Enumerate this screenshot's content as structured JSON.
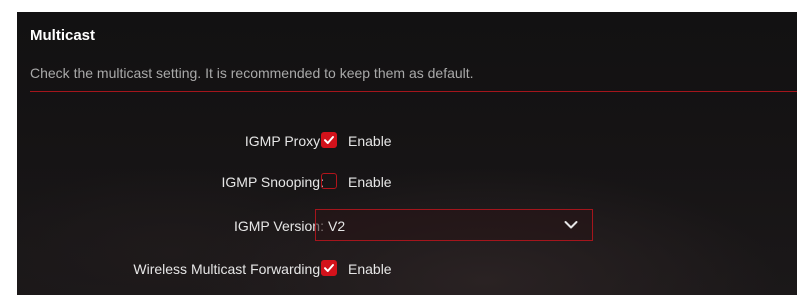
{
  "section": {
    "title": "Multicast",
    "description": "Check the multicast setting. It is recommended to keep them as default."
  },
  "settings": {
    "igmp_proxy": {
      "label": "IGMP Proxy:",
      "checked": true,
      "option_label": "Enable"
    },
    "igmp_snooping": {
      "label": "IGMP Snooping:",
      "checked": false,
      "option_label": "Enable"
    },
    "igmp_version": {
      "label": "IGMP Version:",
      "value": "V2"
    },
    "wireless_multicast_forwarding": {
      "label": "Wireless Multicast Forwarding:",
      "checked": true,
      "option_label": "Enable"
    }
  },
  "colors": {
    "accent": "#d3121b",
    "panel_bg": "#141213",
    "text": "#e6e6e6",
    "muted_text": "#a9a9a9"
  },
  "icons": {
    "checkmark": "checkmark-icon",
    "dropdown": "chevron-down-icon"
  }
}
